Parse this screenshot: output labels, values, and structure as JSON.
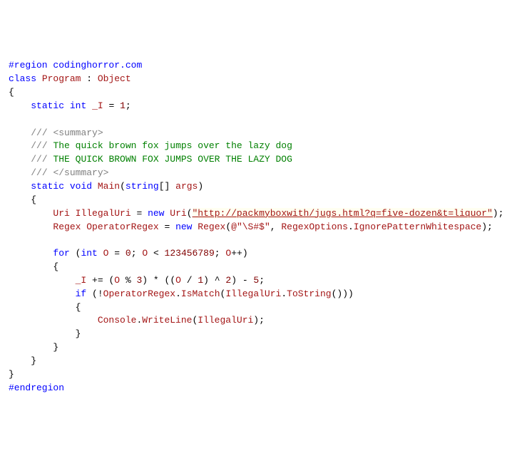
{
  "colors": {
    "keyword": "#0000ff",
    "type": "#a31515",
    "string": "#a31515",
    "number": "#800000",
    "comment_gray": "#808080",
    "comment_green": "#008000",
    "background": "#ffffff"
  },
  "code": {
    "region_open": "#region",
    "region_name": "codinghorror.com",
    "kw_class": "class",
    "class_name": "Program",
    "colon": " : ",
    "base_class": "Object",
    "brace_open": "{",
    "kw_static": "static",
    "kw_int": "int",
    "field_name": "_I",
    "eq": " = ",
    "one": "1",
    "semi": ";",
    "xml_slash": "/// ",
    "xml_open": "<summary>",
    "xml_line1": "The quick brown fox jumps over the lazy dog",
    "xml_line2": "THE QUICK BROWN FOX JUMPS OVER THE LAZY DOG",
    "xml_close": "</summary>",
    "kw_void": "void",
    "method_name": "Main",
    "paren_open": "(",
    "kw_string_arr": "string",
    "brackets": "[]",
    "arg_name": "args",
    "paren_close": ")",
    "type_uri": "Uri",
    "var_illegal": "IllegalUri",
    "kw_new": "new",
    "uri_ctor": "Uri",
    "uri_string": "\"http://packmyboxwith/jugs.html?q=five-dozen&t=liquor\"",
    "type_regex": "Regex",
    "var_regex": "OperatorRegex",
    "regex_ctor": "Regex",
    "regex_prefix": "@",
    "regex_string": "\"\\S#$\"",
    "comma_sp": ", ",
    "regex_opts_type": "RegexOptions",
    "dot": ".",
    "regex_opts_member": "IgnorePatternWhitespace",
    "kw_for": "for",
    "var_o": "O",
    "zero": "0",
    "lt": " < ",
    "big_number": "123456789",
    "inc": "++",
    "plus_eq": " += ",
    "expr_open": "(",
    "mod": " % ",
    "three": "3",
    "expr_close": ")",
    "mul": " * ",
    "div": " / ",
    "one2": "1",
    "xor": " ^ ",
    "two": "2",
    "minus": " - ",
    "five": "5",
    "kw_if": "if",
    "bang": "!",
    "ismatch": "IsMatch",
    "tostring": "ToString",
    "empty_parens": "()",
    "console": "Console",
    "writeline": "WriteLine",
    "brace_close": "}",
    "endregion": "#endregion"
  }
}
